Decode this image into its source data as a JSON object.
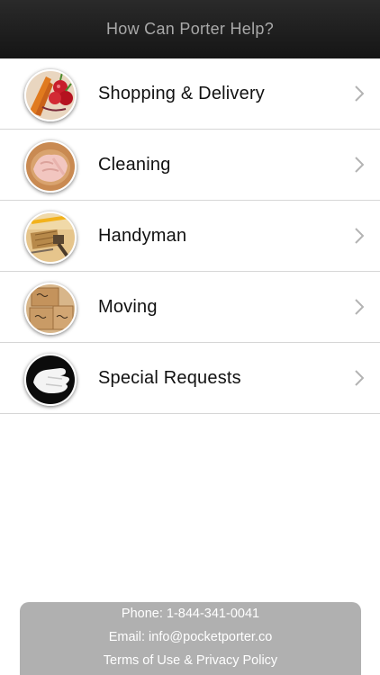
{
  "header": {
    "title": "How Can Porter Help?"
  },
  "services": [
    {
      "label": "Shopping & Delivery",
      "icon": "groceries-icon"
    },
    {
      "label": "Cleaning",
      "icon": "cleaning-glove-icon"
    },
    {
      "label": "Handyman",
      "icon": "tools-icon"
    },
    {
      "label": "Moving",
      "icon": "moving-boxes-icon"
    },
    {
      "label": "Special Requests",
      "icon": "white-glove-icon"
    }
  ],
  "footer": {
    "phone": "Phone: 1-844-341-0041",
    "email": "Email: info@pocketporter.co",
    "terms": "Terms of Use & Privacy Policy"
  },
  "colors": {
    "nav_background": "#1c1c1c",
    "nav_title": "#a9a9a9",
    "footer_background": "#b0b0b0",
    "divider": "#d6d6d6"
  }
}
